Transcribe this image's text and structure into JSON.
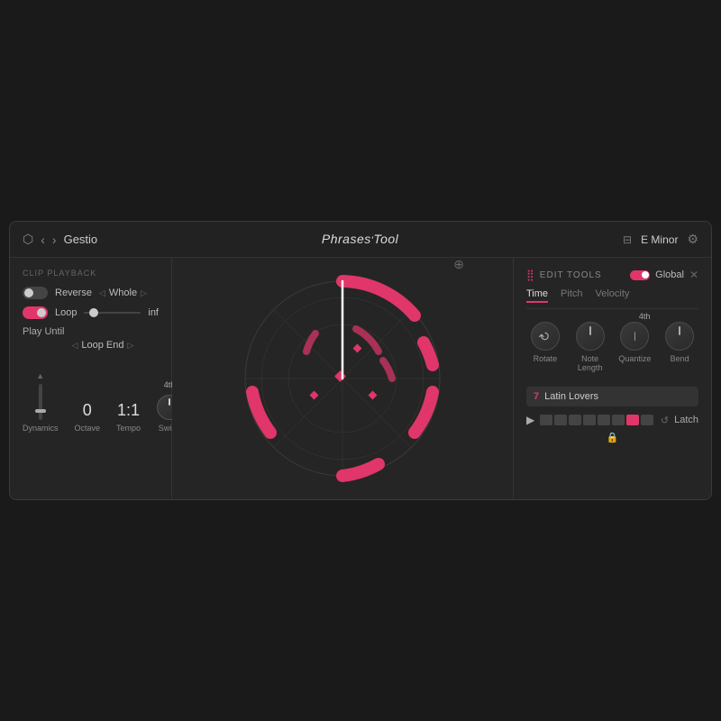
{
  "titleBar": {
    "appIcon": "⬡",
    "navBack": "‹",
    "navForward": "›",
    "appName": "Gestio",
    "pluginTitleMain": "Phrases",
    "pluginTitleSub": "'",
    "pluginTitleEnd": "Tool",
    "saveIcon": "⊟",
    "keyLabel": "E  Minor",
    "settingsIcon": "⚙"
  },
  "clipPlayback": {
    "sectionLabel": "CLIP PLAYBACK",
    "reverseLabel": "Reverse",
    "reverseActive": false,
    "wholeLabel": "Whole",
    "loopLabel": "Loop",
    "loopActive": true,
    "sliderValue": "inf",
    "playUntilLabel": "Play Until",
    "loopEndLabel": "Loop End"
  },
  "bottomControls": {
    "dynamicsLabel": "Dynamics",
    "octaveValue": "0",
    "octaveLabel": "Octave",
    "tempoValue": "1:1",
    "tempoLabel": "Tempo",
    "swingLabel": "Swing",
    "swingSuperscript": "4th"
  },
  "editTools": {
    "sectionLabel": "EDIT TOOLS",
    "globalLabel": "Global",
    "globalActive": true,
    "tabs": [
      {
        "label": "Time",
        "active": true
      },
      {
        "label": "Pitch",
        "active": false
      },
      {
        "label": "Velocity",
        "active": false
      }
    ],
    "tools": [
      {
        "label": "Rotate",
        "type": "rotate"
      },
      {
        "label": "Note Length",
        "type": "center"
      },
      {
        "label": "Quantize",
        "type": "center",
        "superscript": "4th"
      },
      {
        "label": "Bend",
        "type": "center"
      }
    ]
  },
  "phraseSelector": {
    "number": "7",
    "name": "Latin Lovers"
  },
  "sequencer": {
    "blocks": [
      false,
      false,
      false,
      false,
      false,
      false,
      true,
      false
    ],
    "latchLabel": "Latch"
  }
}
